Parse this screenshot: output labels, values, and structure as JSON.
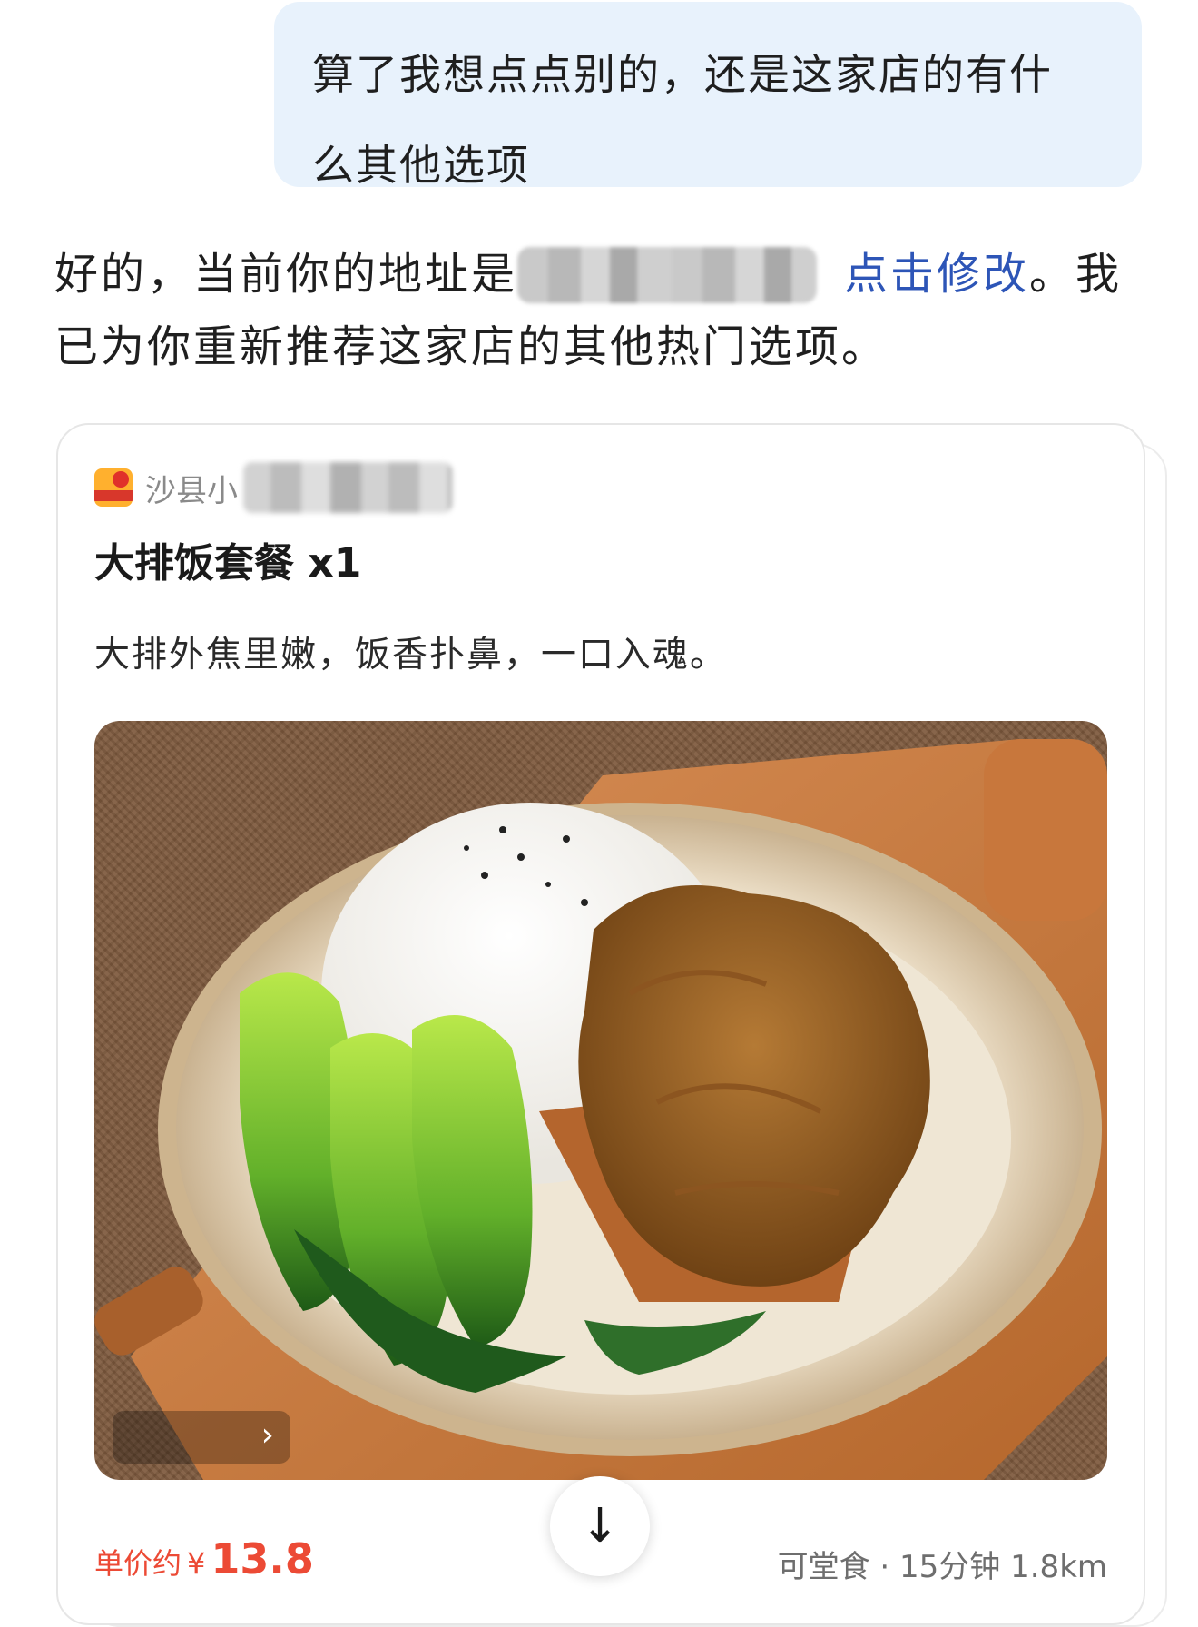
{
  "user_message": {
    "line1": "算了我想点点别的，还是这家店的有什",
    "line2": "么其他选项"
  },
  "bot_reply": {
    "part1": "好的，当前你的地址是",
    "link": "点击修改",
    "part2": "。我",
    "line2": "已为你重新推荐这家店的其他热门选项。"
  },
  "card": {
    "shop_name": "沙县小",
    "item_title": "大排饭套餐 x1",
    "item_desc": "大排外焦里嫩，饭香扑鼻，一口入魂。",
    "price_label": "单价约",
    "currency": "¥",
    "price": "13.8",
    "meta": "可堂食 · 15分钟 1.8km",
    "photo_nav_icon": "chevron-right-icon"
  },
  "scroll_button_icon": "arrow-down-icon",
  "colors": {
    "bubble_bg": "#e8f2fc",
    "link": "#2d55b7",
    "price": "#ec4a35"
  }
}
